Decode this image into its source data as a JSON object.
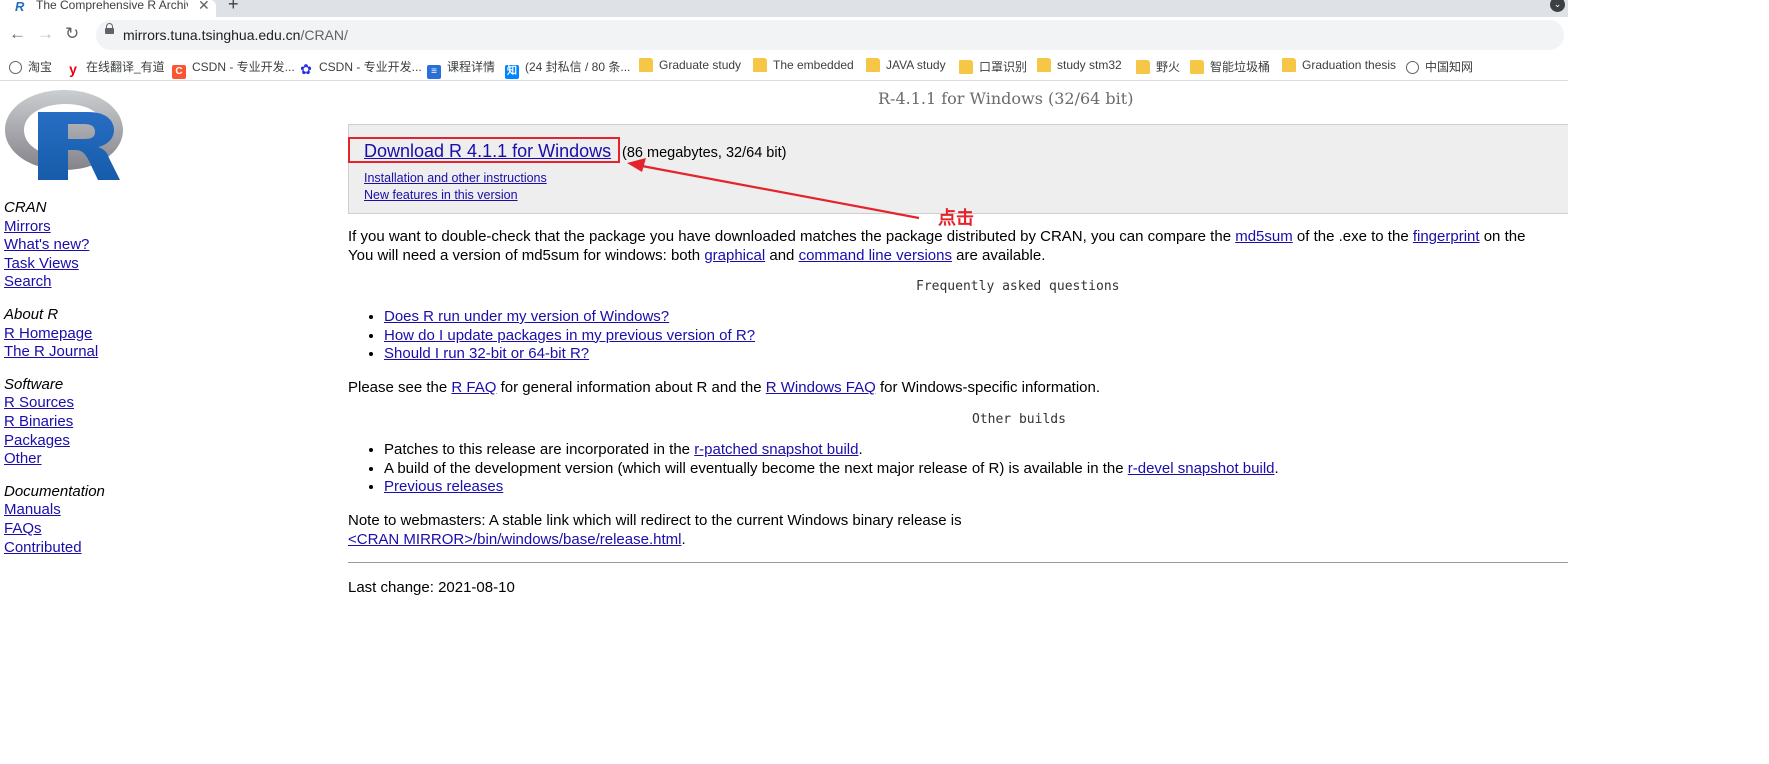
{
  "browser": {
    "tab_title": "The Comprehensive R Archive",
    "tab_favicon": "R",
    "url_host": "mirrors.tuna.tsinghua.edu.cn",
    "url_path": "/CRAN/"
  },
  "bookmarks": [
    {
      "label": "淘宝",
      "icon": "globe-icon"
    },
    {
      "label": "在线翻译_有道",
      "icon": "youdao-icon"
    },
    {
      "label": "CSDN - 专业开发...",
      "icon": "csdn-icon"
    },
    {
      "label": "CSDN - 专业开发...",
      "icon": "baidu-paw-icon"
    },
    {
      "label": "课程详情",
      "icon": "course-icon"
    },
    {
      "label": "(24 封私信 / 80 条...",
      "icon": "zhihu-icon"
    },
    {
      "label": "Graduate study",
      "icon": "folder-icon"
    },
    {
      "label": "The embedded",
      "icon": "folder-icon"
    },
    {
      "label": "JAVA study",
      "icon": "folder-icon"
    },
    {
      "label": "口罩识别",
      "icon": "folder-icon"
    },
    {
      "label": "study stm32",
      "icon": "folder-icon"
    },
    {
      "label": "野火",
      "icon": "folder-icon"
    },
    {
      "label": "智能垃圾桶",
      "icon": "folder-icon"
    },
    {
      "label": "Graduation thesis",
      "icon": "folder-icon"
    },
    {
      "label": "中国知网",
      "icon": "globe-icon"
    }
  ],
  "sidebar": {
    "groups": [
      {
        "heading": "CRAN",
        "links": [
          "Mirrors",
          "What's new?",
          "Task Views",
          "Search"
        ]
      },
      {
        "heading": "About R",
        "links": [
          "R Homepage",
          "The R Journal"
        ]
      },
      {
        "heading": "Software",
        "links": [
          "R Sources",
          "R Binaries",
          "Packages",
          "Other"
        ]
      },
      {
        "heading": "Documentation",
        "links": [
          "Manuals",
          "FAQs",
          "Contributed"
        ]
      }
    ]
  },
  "page": {
    "title": "R-4.1.1 for Windows (32/64 bit)",
    "download_link": "Download R 4.1.1 for Windows",
    "download_size": "(86 megabytes, 32/64 bit)",
    "install_link": "Installation and other instructions",
    "new_features_link": "New features in this version",
    "annotation": "点击",
    "check": {
      "t1": "If you want to double-check that the package you have downloaded matches the package distributed by CRAN, you can compare the ",
      "md5sum_link": "md5sum",
      "t2": " of the .exe to the ",
      "fingerprint_link": "fingerprint",
      "t3": " on the",
      "t4": "You will need a version of md5sum for windows: both ",
      "graphical_link": "graphical",
      "t5": " and ",
      "cmdline_link": "command line versions",
      "t6": " are available."
    },
    "faq_heading": "Frequently asked questions",
    "faq_items": [
      "Does R run under my version of Windows?",
      "How do I update packages in my previous version of R?",
      "Should I run 32-bit or 64-bit R?"
    ],
    "faq_para": {
      "t1": "Please see the ",
      "rfaq_link": "R FAQ",
      "t2": " for general information about R and the ",
      "rwinfaq_link": "R Windows FAQ",
      "t3": " for Windows-specific information."
    },
    "other_heading": "Other builds",
    "other": {
      "i1_text": "Patches to this release are incorporated in the ",
      "i1_link": "r-patched snapshot build",
      "i1_end": ".",
      "i2_text": "A build of the development version (which will eventually become the next major release of R) is available in the ",
      "i2_link": "r-devel snapshot build",
      "i2_end": ".",
      "i3_link": "Previous releases"
    },
    "webmaster_text": "Note to webmasters: A stable link which will redirect to the current Windows binary release is",
    "webmaster_link": "<CRAN MIRROR>/bin/windows/base/release.html",
    "webmaster_end": ".",
    "last_change": "Last change: 2021-08-10"
  },
  "colors": {
    "link": "#1a0dab",
    "annotation": "#e3242b",
    "download_box": "#eeeeee"
  }
}
